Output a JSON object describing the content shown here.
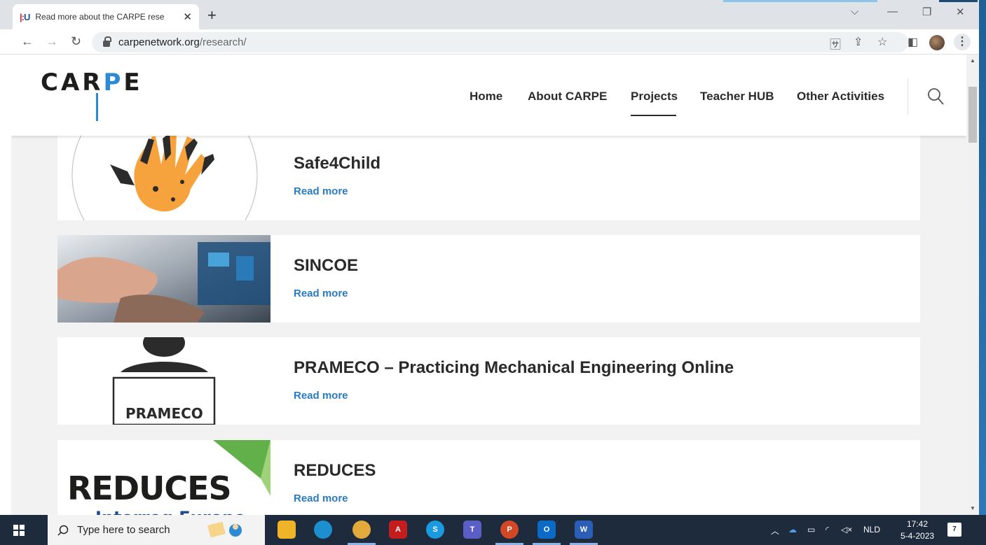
{
  "browser": {
    "tab": {
      "title": "Read more about the CARPE rese",
      "favicon": "!!U"
    },
    "url": {
      "host": "carpenetwork.org",
      "path": "/research/"
    }
  },
  "site": {
    "logo": {
      "c": "C",
      "a": "A",
      "r": "R",
      "p": "P",
      "e": "E"
    },
    "nav": [
      "Home",
      "About CARPE",
      "Projects",
      "Teacher HUB",
      "Other Activities"
    ],
    "active_nav": "Projects"
  },
  "projects": [
    {
      "title": "Safe4Child",
      "link": "Read more"
    },
    {
      "title": "SINCOE",
      "link": "Read more"
    },
    {
      "title": "PRAMECO – Practicing Mechanical Engineering Online",
      "link": "Read more",
      "thumb_label": "PRAMECO"
    },
    {
      "title": "REDUCES",
      "link": "Read more",
      "thumb_label": "REDUCES",
      "thumb_sub": "Interreg Europe"
    }
  ],
  "taskbar": {
    "search_placeholder": "Type here to search",
    "lang": "NLD",
    "time": "17:42",
    "date": "5-4-2023",
    "notifications": "7"
  }
}
